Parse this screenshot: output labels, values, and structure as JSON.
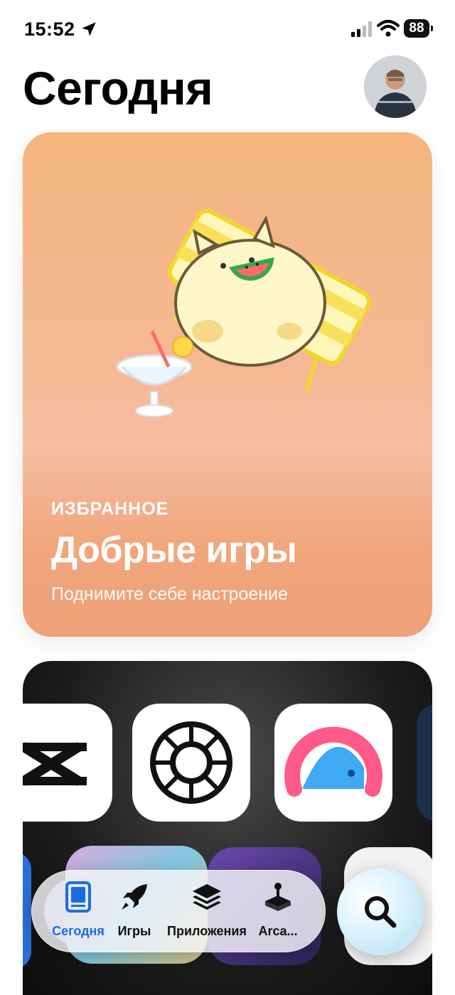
{
  "status_bar": {
    "time": "15:52",
    "battery": "88"
  },
  "header": {
    "title": "Сегодня"
  },
  "featured": {
    "eyebrow": "ИЗБРАННОЕ",
    "headline": "Добрые игры",
    "subhead": "Поднимите себе настроение"
  },
  "tabs": [
    {
      "label": "Сегодня",
      "icon": "today-icon",
      "selected": true
    },
    {
      "label": "Игры",
      "icon": "rocket-icon"
    },
    {
      "label": "Приложения",
      "icon": "layers-icon"
    },
    {
      "label": "Arca...",
      "icon": "joystick-icon"
    }
  ],
  "colors": {
    "accent": "#1a6de0",
    "card_top": "#f4b57e",
    "card_bottom": "#f0a07a"
  }
}
